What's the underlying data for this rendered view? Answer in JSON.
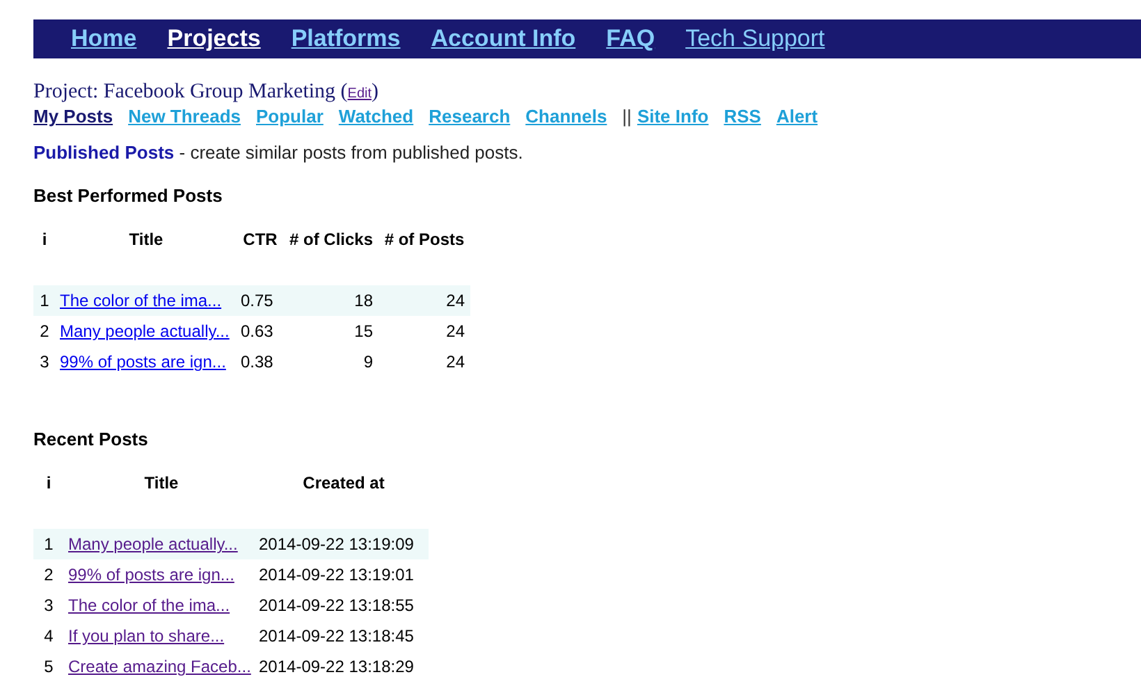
{
  "nav": [
    {
      "label": "Home",
      "selected": false,
      "kind": "bold"
    },
    {
      "label": "Projects",
      "selected": true,
      "kind": "bold"
    },
    {
      "label": "Platforms",
      "selected": false,
      "kind": "bold"
    },
    {
      "label": "Account Info",
      "selected": false,
      "kind": "bold"
    },
    {
      "label": "FAQ",
      "selected": false,
      "kind": "bold"
    },
    {
      "label": "Tech Support",
      "selected": false,
      "kind": "plain"
    }
  ],
  "project": {
    "label": "Project: Facebook Group Marketing",
    "open_paren": "(",
    "edit": "Edit",
    "close_paren": ")"
  },
  "subnav": [
    {
      "kind": "link",
      "label": "My Posts",
      "selected": true
    },
    {
      "kind": "link",
      "label": "New Threads",
      "selected": false
    },
    {
      "kind": "link",
      "label": "Popular",
      "selected": false
    },
    {
      "kind": "link",
      "label": "Watched",
      "selected": false
    },
    {
      "kind": "link",
      "label": "Research",
      "selected": false
    },
    {
      "kind": "link",
      "label": "Channels",
      "selected": false
    },
    {
      "kind": "separator",
      "label": "||"
    },
    {
      "kind": "link",
      "label": "Site Info",
      "selected": false
    },
    {
      "kind": "link",
      "label": "RSS",
      "selected": false
    },
    {
      "kind": "link",
      "label": "Alert",
      "selected": false
    }
  ],
  "intro": {
    "title": "Published Posts",
    "text": "- create similar posts from published posts."
  },
  "best": {
    "heading": "Best Performed Posts",
    "columns": [
      "i",
      "Title",
      "CTR",
      "# of Clicks",
      "# of Posts"
    ],
    "rows": [
      {
        "i": "1",
        "title": "The color of the ima...",
        "ctr": "0.75",
        "clicks": "18",
        "posts": "24",
        "highlighted": true,
        "visited": false
      },
      {
        "i": "2",
        "title": "Many people actually...",
        "ctr": "0.63",
        "clicks": "15",
        "posts": "24",
        "highlighted": false,
        "visited": false
      },
      {
        "i": "3",
        "title": "99% of posts are ign...",
        "ctr": "0.38",
        "clicks": "9",
        "posts": "24",
        "highlighted": false,
        "visited": false
      }
    ]
  },
  "recent": {
    "heading": "Recent Posts",
    "columns": [
      "i",
      "Title",
      "Created at"
    ],
    "rows": [
      {
        "i": "1",
        "title": "Many people actually...",
        "created": "2014-09-22 13:19:09",
        "highlighted": true,
        "visited": true
      },
      {
        "i": "2",
        "title": "99% of posts are ign...",
        "created": "2014-09-22 13:19:01",
        "highlighted": false,
        "visited": true
      },
      {
        "i": "3",
        "title": "The color of the ima...",
        "created": "2014-09-22 13:18:55",
        "highlighted": false,
        "visited": true
      },
      {
        "i": "4",
        "title": "If you plan to share...",
        "created": "2014-09-22 13:18:45",
        "highlighted": false,
        "visited": true
      },
      {
        "i": "5",
        "title": "Create amazing Faceb...",
        "created": "2014-09-22 13:18:29",
        "highlighted": false,
        "visited": true
      }
    ]
  }
}
